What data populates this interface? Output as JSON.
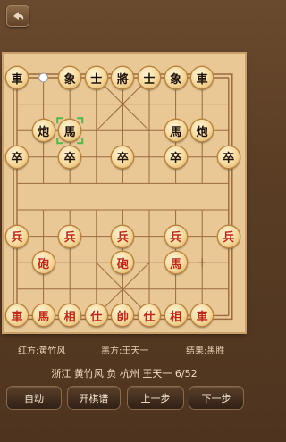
{
  "board": {
    "pieces": [
      {
        "char": "車",
        "side": "black",
        "col": 0,
        "row": 0
      },
      {
        "char": "象",
        "side": "black",
        "col": 2,
        "row": 0
      },
      {
        "char": "士",
        "side": "black",
        "col": 3,
        "row": 0
      },
      {
        "char": "將",
        "side": "black",
        "col": 4,
        "row": 0
      },
      {
        "char": "士",
        "side": "black",
        "col": 5,
        "row": 0
      },
      {
        "char": "象",
        "side": "black",
        "col": 6,
        "row": 0
      },
      {
        "char": "車",
        "side": "black",
        "col": 7,
        "row": 0
      },
      {
        "char": "炮",
        "side": "black",
        "col": 1,
        "row": 2
      },
      {
        "char": "馬",
        "side": "black",
        "col": 2,
        "row": 2
      },
      {
        "char": "馬",
        "side": "black",
        "col": 6,
        "row": 2
      },
      {
        "char": "炮",
        "side": "black",
        "col": 7,
        "row": 2
      },
      {
        "char": "卒",
        "side": "black",
        "col": 0,
        "row": 3
      },
      {
        "char": "卒",
        "side": "black",
        "col": 2,
        "row": 3
      },
      {
        "char": "卒",
        "side": "black",
        "col": 4,
        "row": 3
      },
      {
        "char": "卒",
        "side": "black",
        "col": 6,
        "row": 3
      },
      {
        "char": "卒",
        "side": "black",
        "col": 8,
        "row": 3
      },
      {
        "char": "兵",
        "side": "red",
        "col": 0,
        "row": 6
      },
      {
        "char": "兵",
        "side": "red",
        "col": 2,
        "row": 6
      },
      {
        "char": "兵",
        "side": "red",
        "col": 4,
        "row": 6
      },
      {
        "char": "兵",
        "side": "red",
        "col": 6,
        "row": 6
      },
      {
        "char": "兵",
        "side": "red",
        "col": 8,
        "row": 6
      },
      {
        "char": "砲",
        "side": "red",
        "col": 1,
        "row": 7
      },
      {
        "char": "砲",
        "side": "red",
        "col": 4,
        "row": 7
      },
      {
        "char": "馬",
        "side": "red",
        "col": 6,
        "row": 7
      },
      {
        "char": "車",
        "side": "red",
        "col": 0,
        "row": 9
      },
      {
        "char": "馬",
        "side": "red",
        "col": 1,
        "row": 9
      },
      {
        "char": "相",
        "side": "red",
        "col": 2,
        "row": 9
      },
      {
        "char": "仕",
        "side": "red",
        "col": 3,
        "row": 9
      },
      {
        "char": "帥",
        "side": "red",
        "col": 4,
        "row": 9
      },
      {
        "char": "仕",
        "side": "red",
        "col": 5,
        "row": 9
      },
      {
        "char": "相",
        "side": "red",
        "col": 6,
        "row": 9
      },
      {
        "char": "車",
        "side": "red",
        "col": 7,
        "row": 9
      }
    ],
    "last_move_from": {
      "col": 1,
      "row": 0
    },
    "last_move_to": {
      "col": 2,
      "row": 2
    },
    "move_target_hint": {
      "col": 7,
      "row": 7
    }
  },
  "info": {
    "red_player": "红方:黄竹风",
    "black_player": "黑方:王天一",
    "result": "结果:黑胜"
  },
  "summary": "浙江 黄竹风 负 杭州 王天一  6/52",
  "buttons": {
    "auto": "自动",
    "open_book": "开棋谱",
    "prev": "上一步",
    "next": "下一步"
  },
  "colors": {
    "red_piece_text": "#c0281a",
    "black_piece_text": "#1e1208",
    "board_line": "#9a6a3c",
    "highlight": "#4fb84a"
  }
}
